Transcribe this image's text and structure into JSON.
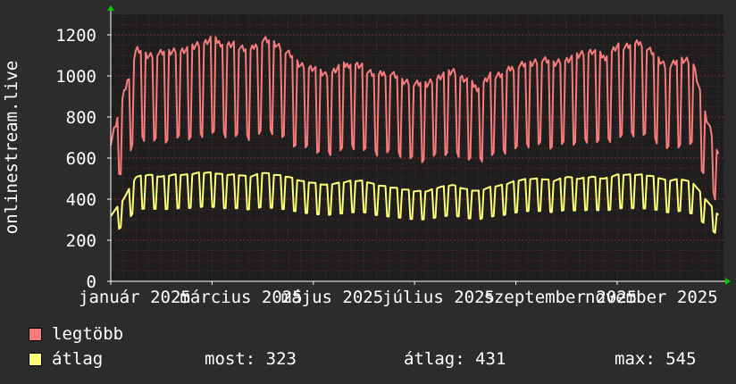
{
  "chart_data": {
    "type": "line",
    "title": "",
    "ylabel": "onlinestream.live",
    "xlabel": "",
    "ylim": [
      0,
      1300
    ],
    "yticks": [
      0,
      200,
      400,
      600,
      800,
      1000,
      1200
    ],
    "grid": true,
    "x_tick_labels": [
      "január 2025",
      "március 2025",
      "május 2025",
      "július 2025",
      "szeptember 2025",
      "november 2025"
    ],
    "x_tick_positions": [
      0.0,
      2.0,
      4.0,
      6.0,
      8.0,
      10.0
    ],
    "x_range": [
      0.0,
      12.1
    ],
    "series": [
      {
        "name": "legtöbb",
        "color": "#f77b7b",
        "x": [
          0.0,
          0.25,
          0.5,
          0.75,
          1.0,
          1.25,
          1.5,
          1.75,
          2.0,
          2.25,
          2.5,
          2.75,
          3.0,
          3.25,
          3.5,
          3.75,
          4.0,
          4.25,
          4.5,
          4.75,
          5.0,
          5.25,
          5.5,
          5.75,
          6.0,
          6.25,
          6.5,
          6.75,
          7.0,
          7.25,
          7.5,
          7.75,
          8.0,
          8.25,
          8.5,
          8.75,
          9.0,
          9.25,
          9.5,
          9.75,
          10.0,
          10.25,
          10.5,
          10.75,
          11.0,
          11.25,
          11.5,
          11.75,
          12.0
        ],
        "y": [
          680,
          900,
          1130,
          1100,
          1110,
          1120,
          1130,
          1150,
          1180,
          1150,
          1150,
          1120,
          1180,
          1160,
          1110,
          1050,
          1040,
          1000,
          1040,
          1060,
          1040,
          1000,
          1020,
          980,
          960,
          960,
          1000,
          1020,
          980,
          940,
          1000,
          1010,
          1050,
          1060,
          1080,
          1060,
          1080,
          1100,
          1120,
          1090,
          1140,
          1150,
          1160,
          1100,
          1040,
          1080,
          1070,
          800,
          620
        ]
      },
      {
        "name": "átlag",
        "color": "#ffff77",
        "x": [
          0.0,
          0.25,
          0.5,
          0.75,
          1.0,
          1.25,
          1.5,
          1.75,
          2.0,
          2.25,
          2.5,
          2.75,
          3.0,
          3.25,
          3.5,
          3.75,
          4.0,
          4.25,
          4.5,
          4.75,
          5.0,
          5.25,
          5.5,
          5.75,
          6.0,
          6.25,
          6.5,
          6.75,
          7.0,
          7.25,
          7.5,
          7.75,
          8.0,
          8.25,
          8.5,
          8.75,
          9.0,
          9.25,
          9.5,
          9.75,
          10.0,
          10.25,
          10.5,
          10.75,
          11.0,
          11.25,
          11.5,
          11.75,
          12.0
        ],
        "y": [
          320,
          400,
          510,
          520,
          510,
          520,
          520,
          530,
          530,
          520,
          520,
          510,
          530,
          520,
          510,
          490,
          480,
          470,
          480,
          490,
          490,
          470,
          460,
          450,
          440,
          440,
          460,
          470,
          450,
          440,
          460,
          470,
          490,
          500,
          500,
          490,
          510,
          500,
          510,
          500,
          520,
          520,
          520,
          510,
          490,
          500,
          480,
          400,
          323
        ]
      }
    ]
  },
  "legend": {
    "max_label": "legtöbb",
    "avg_label": "átlag",
    "stats": [
      {
        "label": "most:",
        "value": "323"
      },
      {
        "label": "átlag:",
        "value": "431"
      },
      {
        "label": "max:",
        "value": "545"
      }
    ]
  },
  "colors": {
    "background": "#2c2c2c",
    "plot_background": "#1e1e1e",
    "grid": "#5a2a2a",
    "axis": "#ffffff",
    "arrow": "#00cc00"
  }
}
